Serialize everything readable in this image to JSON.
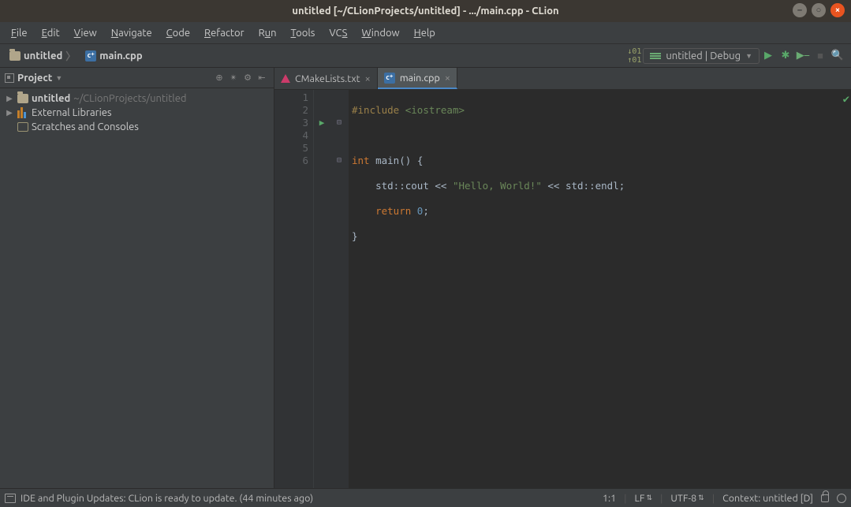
{
  "titlebar": {
    "title": "untitled [~/CLionProjects/untitled] - .../main.cpp - CLion"
  },
  "menu": [
    "File",
    "Edit",
    "View",
    "Navigate",
    "Code",
    "Refactor",
    "Run",
    "Tools",
    "VCS",
    "Window",
    "Help"
  ],
  "breadcrumbs": {
    "project": "untitled",
    "file": "main.cpp"
  },
  "run_config": {
    "label": "untitled | Debug"
  },
  "sidebar": {
    "title": "Project",
    "items": [
      {
        "label": "untitled",
        "path": "~/CLionProjects/untitled",
        "expandable": true
      },
      {
        "label": "External Libraries",
        "expandable": true
      },
      {
        "label": "Scratches and Consoles",
        "expandable": false
      }
    ]
  },
  "tabs": [
    {
      "label": "CMakeLists.txt",
      "active": false
    },
    {
      "label": "main.cpp",
      "active": true
    }
  ],
  "code": {
    "line_numbers": [
      "1",
      "2",
      "3",
      "4",
      "5",
      "6"
    ],
    "tokens": {
      "include": "#include",
      "iostream": "<iostream>",
      "int": "int",
      "main": "main",
      "parens": "()",
      "brace_open": "{",
      "std_cout": "std::cout",
      "lshift1": "<<",
      "hello": "\"Hello, World!\"",
      "lshift2": "<<",
      "std_endl": "std::endl",
      "semi": ";",
      "return": "return",
      "zero": "0",
      "brace_close": "}"
    }
  },
  "status": {
    "message": "IDE and Plugin Updates: CLion is ready to update. (44 minutes ago)",
    "pos": "1:1",
    "le": "LF",
    "enc": "UTF-8",
    "ctx": "Context: untitled [D]"
  }
}
